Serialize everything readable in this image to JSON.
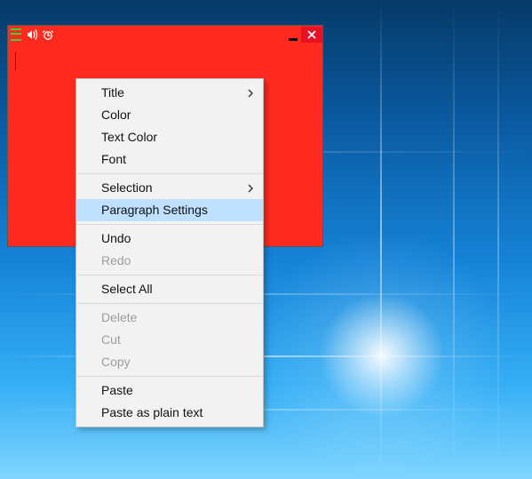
{
  "titlebar": {
    "icons": {
      "hamburger": "menu-icon",
      "speaker": "speaker-icon",
      "clock": "alarm-icon"
    },
    "minimize": "minimize",
    "close": "close"
  },
  "context_menu": {
    "items": [
      {
        "label": "Title",
        "submenu": true,
        "disabled": false
      },
      {
        "label": "Color",
        "submenu": false,
        "disabled": false
      },
      {
        "label": "Text Color",
        "submenu": false,
        "disabled": false
      },
      {
        "label": "Font",
        "submenu": false,
        "disabled": false
      },
      {
        "sep": true
      },
      {
        "label": "Selection",
        "submenu": true,
        "disabled": false
      },
      {
        "label": "Paragraph Settings",
        "submenu": false,
        "disabled": false,
        "hover": true
      },
      {
        "sep": true
      },
      {
        "label": "Undo",
        "submenu": false,
        "disabled": false
      },
      {
        "label": "Redo",
        "submenu": false,
        "disabled": true
      },
      {
        "sep": true
      },
      {
        "label": "Select All",
        "submenu": false,
        "disabled": false
      },
      {
        "sep": true
      },
      {
        "label": "Delete",
        "submenu": false,
        "disabled": true
      },
      {
        "label": "Cut",
        "submenu": false,
        "disabled": true
      },
      {
        "label": "Copy",
        "submenu": false,
        "disabled": true
      },
      {
        "sep": true
      },
      {
        "label": "Paste",
        "submenu": false,
        "disabled": false
      },
      {
        "label": "Paste as plain text",
        "submenu": false,
        "disabled": false
      }
    ]
  }
}
